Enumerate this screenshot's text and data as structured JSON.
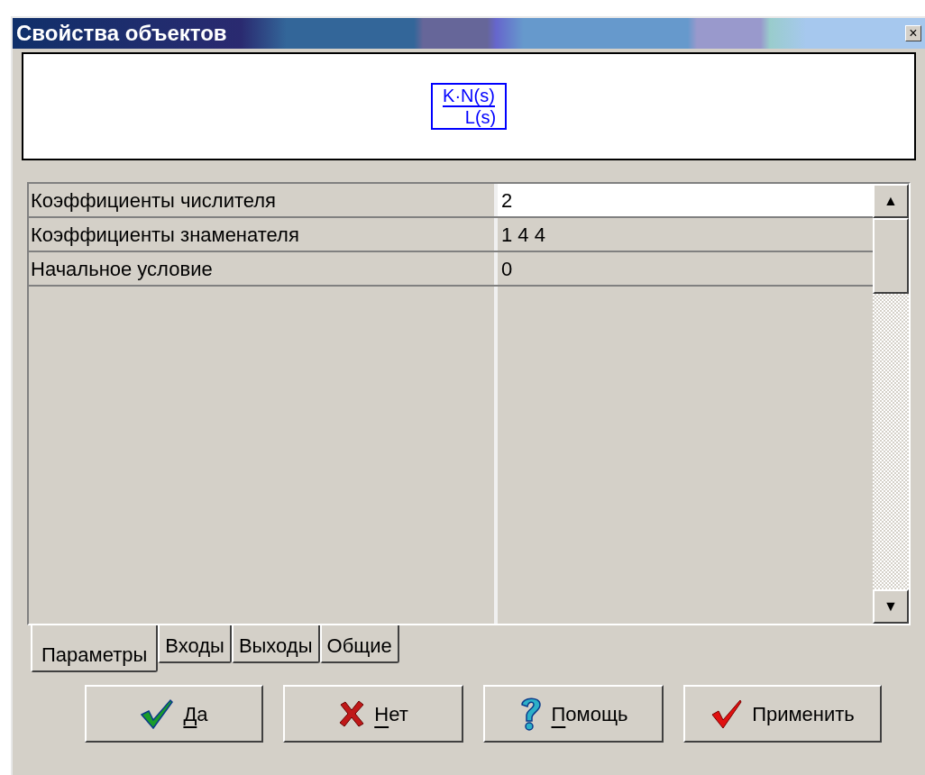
{
  "window": {
    "title": "Свойства объектов",
    "close": "×"
  },
  "preview": {
    "numerator": "K·N(s)",
    "denominator": "L(s)"
  },
  "table": {
    "rows": [
      {
        "name": "Коэффициенты числителя",
        "value": "2",
        "selected": true
      },
      {
        "name": "Коэффициенты знаменателя",
        "value": "1 4 4",
        "selected": false
      },
      {
        "name": "Начальное условие",
        "value": "0",
        "selected": false
      }
    ]
  },
  "scrollbar": {
    "up": "▲",
    "down": "▼"
  },
  "tabs": [
    {
      "label": "Параметры",
      "selected": true
    },
    {
      "label": "Входы",
      "selected": false
    },
    {
      "label": "Выходы",
      "selected": false
    },
    {
      "label": "Общие",
      "selected": false
    }
  ],
  "buttons": [
    {
      "kind": "ok",
      "label": "Да",
      "mnemonic": true
    },
    {
      "kind": "cancel",
      "label": "Нет",
      "mnemonic": true
    },
    {
      "kind": "help",
      "label": "Помощь",
      "mnemonic": true
    },
    {
      "kind": "apply",
      "label": "Применить",
      "mnemonic": false
    }
  ]
}
